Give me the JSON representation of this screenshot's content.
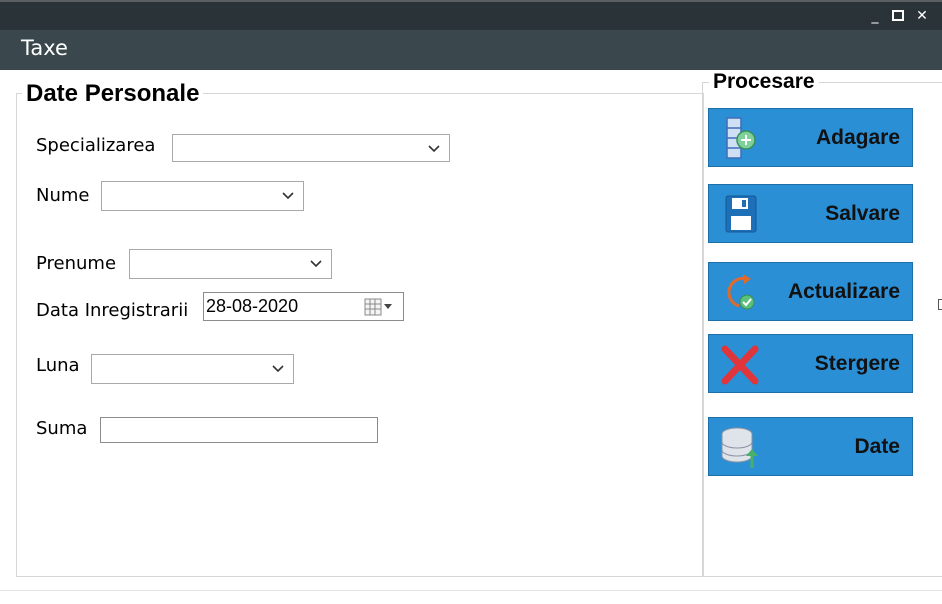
{
  "window": {
    "title": "Taxe",
    "controls": {
      "minimize": "_",
      "maximize": "□",
      "close": "✕"
    }
  },
  "personal_group": {
    "legend": "Date Personale",
    "fields": {
      "specializarea": {
        "label": "Specializarea",
        "value": ""
      },
      "nume": {
        "label": "Nume",
        "value": ""
      },
      "prenume": {
        "label": "Prenume",
        "value": ""
      },
      "data_inregistrarii": {
        "label": "Data Inregistrarii",
        "value": "28-08-2020"
      },
      "luna": {
        "label": "Luna",
        "value": ""
      },
      "suma": {
        "label": "Suma",
        "value": ""
      }
    }
  },
  "process_group": {
    "legend": "Procesare",
    "buttons": [
      {
        "label": "Adagare",
        "icon": "add-server-icon"
      },
      {
        "label": "Salvare",
        "icon": "floppy-disk-icon"
      },
      {
        "label": "Actualizare",
        "icon": "refresh-check-icon"
      },
      {
        "label": "Stergere",
        "icon": "red-x-icon"
      },
      {
        "label": "Date",
        "icon": "database-upload-icon"
      }
    ]
  },
  "colors": {
    "titlebar": "#2a3338",
    "header": "#3a474d",
    "button_fill": "#2b8fd6",
    "delete_icon": "#e0353a"
  }
}
